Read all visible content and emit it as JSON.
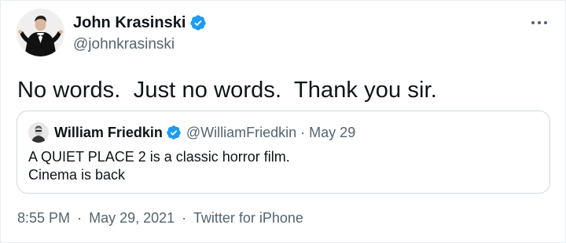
{
  "tweet": {
    "display_name": "John Krasinski",
    "handle": "@johnkrasinski",
    "text": "No words.  Just no words.  Thank you sir.",
    "verified_icon": "verified-badge-icon",
    "more_icon": "more-options-icon",
    "accent_color": "#1d9bf0"
  },
  "quote": {
    "display_name": "William Friedkin",
    "handle": "@WilliamFriedkin",
    "separator": "·",
    "date": "May 29",
    "text_line1": "A QUIET PLACE 2 is a classic horror film.",
    "text_line2": "Cinema is back"
  },
  "footer": {
    "time": "8:55 PM",
    "separator": "·",
    "date": "May 29, 2021",
    "source": "Twitter for iPhone"
  }
}
